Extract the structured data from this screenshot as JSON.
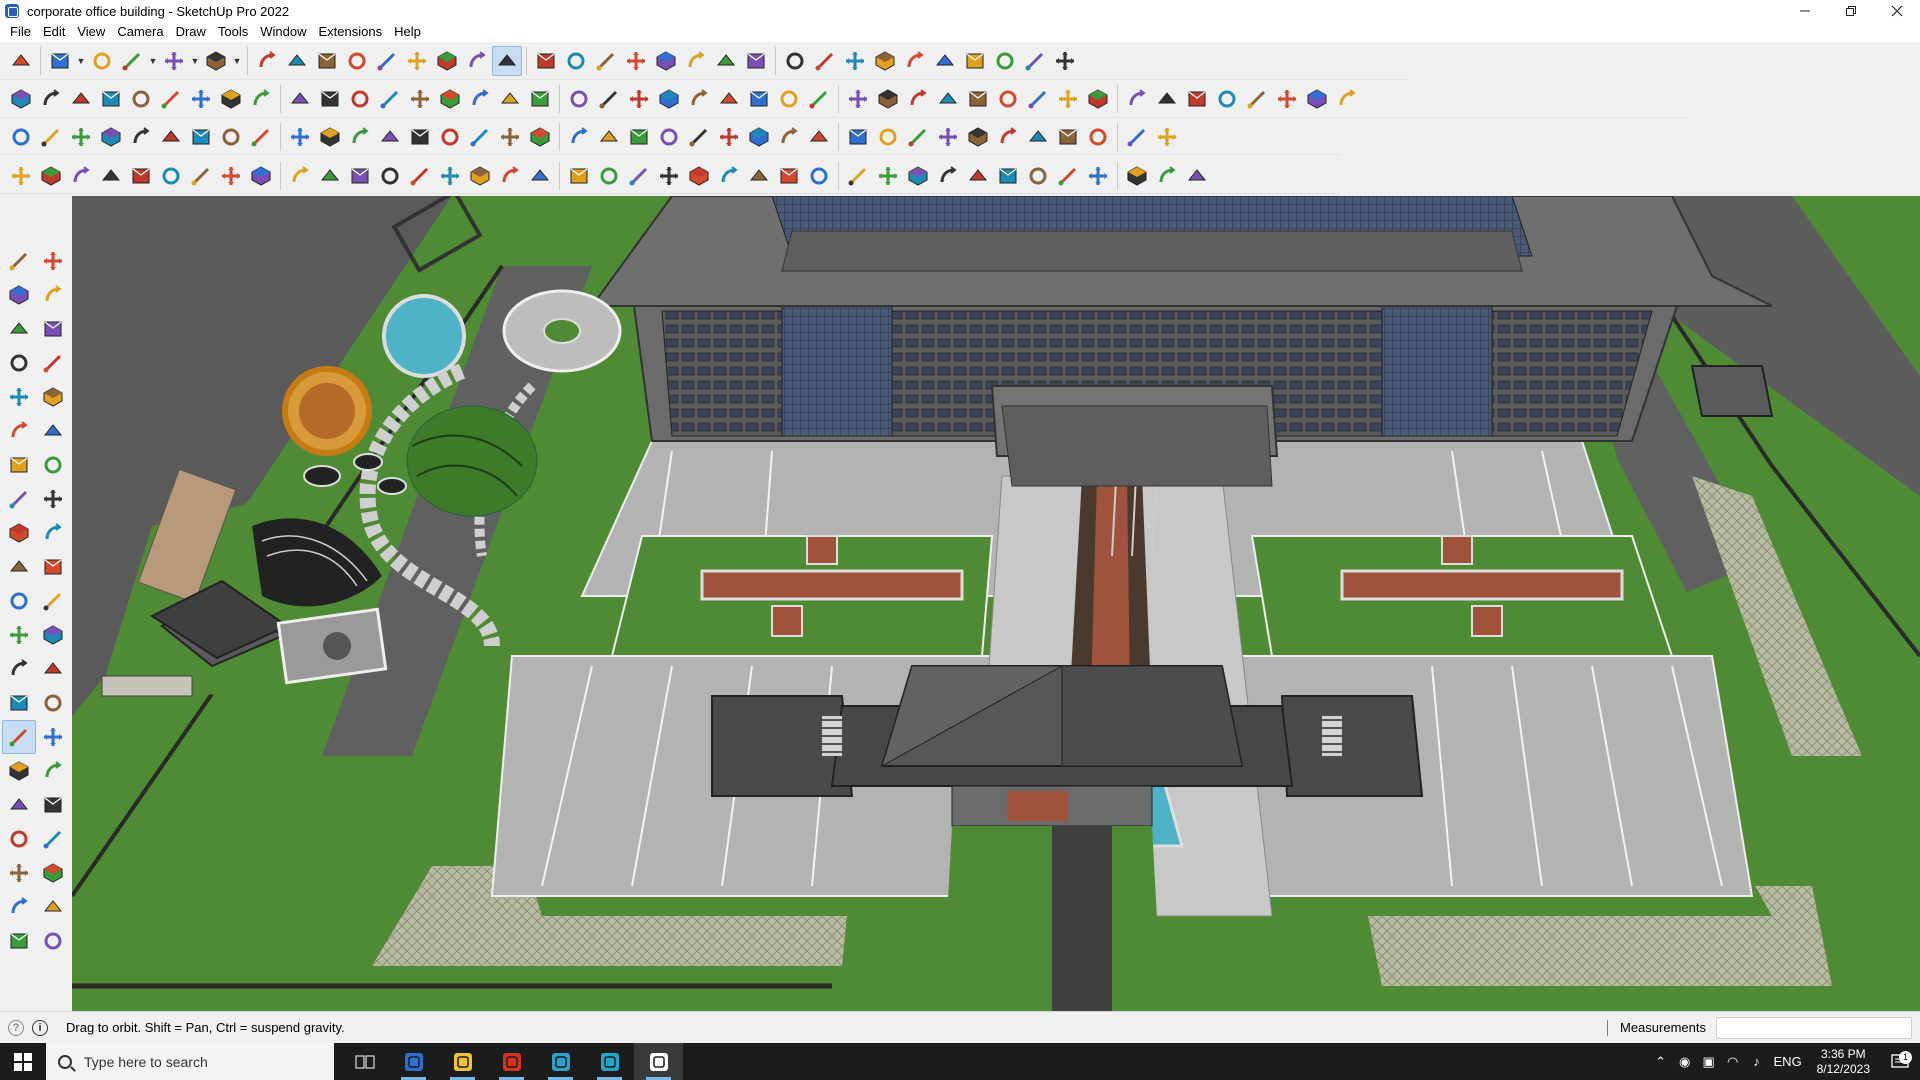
{
  "window": {
    "title": "corporate office building - SketchUp Pro 2022",
    "controls": [
      "minimize-icon",
      "restore-icon",
      "close-icon"
    ]
  },
  "menu": [
    "File",
    "Edit",
    "View",
    "Camera",
    "Draw",
    "Tools",
    "Window",
    "Extensions",
    "Help"
  ],
  "toolbars": {
    "row1": [
      "search-icon",
      "select-icon",
      "eraser-icon",
      "pencil-line-icon",
      "lasso-icon",
      "shape-icon",
      "push-pull-icon",
      "follow-me-icon",
      "move-icon",
      "rotate-icon",
      "scale-icon",
      "tape-icon",
      "text-icon",
      "paint-icon",
      "orbit-icon",
      "pan-icon",
      "zoom-icon",
      "zoom-extents-icon",
      "xray-icon",
      "section-icon",
      "layers-icon",
      "styles-icon",
      "user-icon",
      "warehouse-icon",
      "extension-icon",
      "add-location-icon",
      "sort-icon",
      "sort-reverse-icon",
      "measure-icon",
      "intersect-icon",
      "undo-icon",
      "redo-icon",
      "ruby-icon"
    ],
    "row2_count": 44,
    "row3_count": 38,
    "row4_count": 39
  },
  "left_tools": [
    "select-icon",
    "orbit-icon",
    "paint-icon",
    "eraser-icon",
    "component-icon",
    "tape-icon",
    "line-icon",
    "freehand-icon",
    "rectangle-icon",
    "rotated-rectangle-icon",
    "circle-icon",
    "polygon-icon",
    "arc-icon",
    "pie-icon",
    "arc3-icon",
    "pie2-icon",
    "move-icon",
    "pushpull-icon",
    "rotate-icon",
    "followme-icon",
    "scale-icon",
    "offset-icon",
    "tape-measure-icon",
    "dimension-icon",
    "protractor-icon",
    "text-icon",
    "axes-icon",
    "3dtext-icon",
    "orbit-tool-icon",
    "pan-icon",
    "zoom-icon",
    "zoom-window-icon",
    "zoom-extents-icon",
    "previous-icon",
    "walk-icon",
    "look-around-icon",
    "position-camera-icon",
    "section-plane-icon",
    "section-fill-icon",
    "display-section-icon",
    "display-cuts-icon",
    "xray2-icon"
  ],
  "status": {
    "hint": "Drag to orbit. Shift = Pan, Ctrl = suspend gravity.",
    "measurements_label": "Measurements",
    "measurements_value": ""
  },
  "taskbar": {
    "search_placeholder": "Type here to search",
    "apps": [
      "task-view-icon",
      "calculator-icon",
      "file-explorer-icon",
      "acrobat-icon",
      "teams-icon",
      "edge-icon",
      "sketchup-icon"
    ],
    "language": "ENG",
    "time": "3:36 PM",
    "date": "8/12/2023",
    "notification_count": "1"
  },
  "colors": {
    "grass": "#4f8a35",
    "road": "#5a5a5a",
    "paving": "#b5b5b5",
    "building": "#6b6b6b",
    "glass": "#3b4a66",
    "water": "#4fb3c8",
    "brick": "#a0533c"
  }
}
